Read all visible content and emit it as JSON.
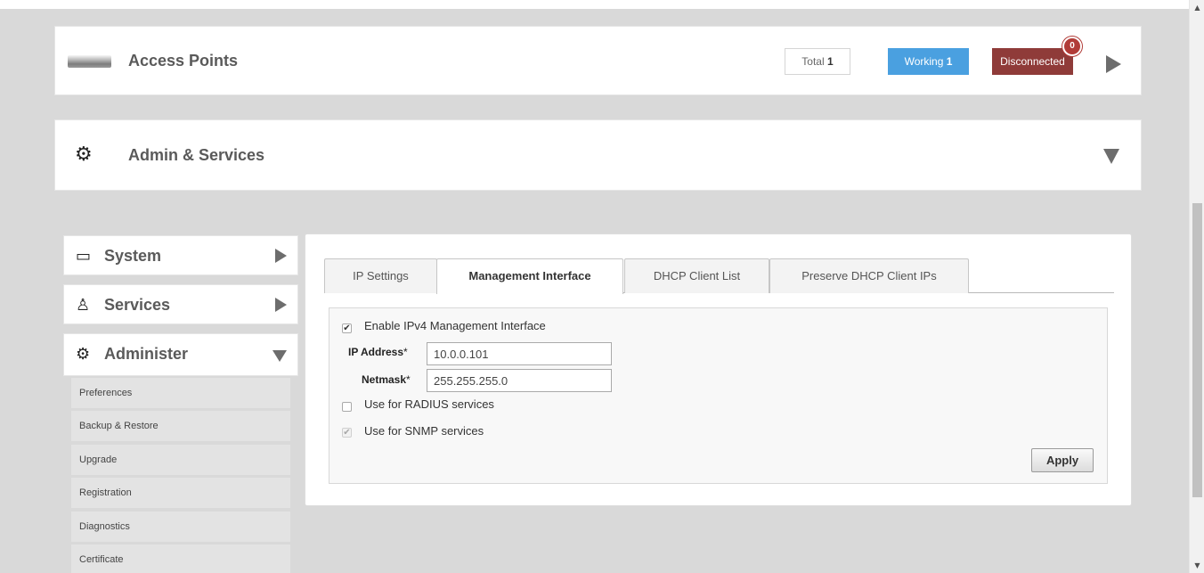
{
  "access_points": {
    "title": "Access Points",
    "total_label": "Total",
    "total_value": "1",
    "working_label": "Working",
    "working_value": "1",
    "disconnected_label": "Disconnected",
    "disconnected_count": "0"
  },
  "admin_services": {
    "title": "Admin & Services"
  },
  "sidebar": {
    "items": [
      {
        "label": "System",
        "icon": "laptop-icon"
      },
      {
        "label": "Services",
        "icon": "services-icon"
      },
      {
        "label": "Administer",
        "icon": "gear-icon"
      }
    ],
    "sub_items": [
      "Preferences",
      "Backup & Restore",
      "Upgrade",
      "Registration",
      "Diagnostics",
      "Certificate"
    ]
  },
  "tabs": [
    {
      "label": "IP Settings"
    },
    {
      "label": "Management Interface",
      "active": true
    },
    {
      "label": "DHCP Client List"
    },
    {
      "label": "Preserve DHCP Client IPs"
    }
  ],
  "form": {
    "enable_ipv4_label": "Enable IPv4 Management Interface",
    "enable_ipv4_checked": true,
    "ip_address_label": "IP Address",
    "ip_address_value": "10.0.0.101",
    "netmask_label": "Netmask",
    "netmask_value": "255.255.255.0",
    "required_mark": "*",
    "radius_label": "Use for RADIUS services",
    "radius_checked": false,
    "snmp_label": "Use for SNMP services",
    "snmp_checked": true,
    "apply_label": "Apply"
  },
  "colors": {
    "working": "#4aa0e0",
    "disconnected": "#8f3b39",
    "background": "#d9d9d9"
  }
}
